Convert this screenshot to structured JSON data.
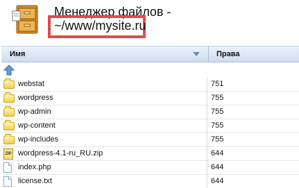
{
  "header": {
    "title": "Менеджер файлов -",
    "path": "~/www/mysite.ru",
    "icon": "file-cabinet-icon",
    "highlight_color": "#e04b4b"
  },
  "table": {
    "columns": {
      "name": "Имя",
      "rights": "Права"
    },
    "up_icon": "up-arrow-icon",
    "rows": [
      {
        "name": "webstat",
        "rights": "751",
        "type": "folder"
      },
      {
        "name": "wordpress",
        "rights": "755",
        "type": "folder"
      },
      {
        "name": "wp-admin",
        "rights": "755",
        "type": "folder"
      },
      {
        "name": "wp-content",
        "rights": "755",
        "type": "folder"
      },
      {
        "name": "wp-includes",
        "rights": "755",
        "type": "folder"
      },
      {
        "name": "wordpress-4.1-ru_RU.zip",
        "rights": "644",
        "type": "zip"
      },
      {
        "name": "index.php",
        "rights": "644",
        "type": "file"
      },
      {
        "name": "license.txt",
        "rights": "644",
        "type": "file"
      }
    ]
  }
}
